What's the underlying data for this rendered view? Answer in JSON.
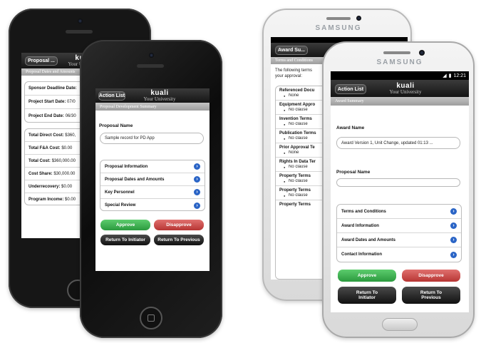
{
  "iphone_back": {
    "action_label": "Proposal ...",
    "logo_text": "kuali",
    "logo_sub": "Your University",
    "subbar": "Proposal Dates and Amounts",
    "dates": [
      {
        "label": "Sponsor Deadline Date:",
        "value": ""
      },
      {
        "label": "Project Start Date:",
        "value": "07/0"
      },
      {
        "label": "Project End Date:",
        "value": "06/30"
      }
    ],
    "costs": [
      {
        "label": "Total Direct Cost:",
        "value": "$360,"
      },
      {
        "label": "Total F&A Cost:",
        "value": "$0.00"
      },
      {
        "label": "Total Cost:",
        "value": "$360,000.00"
      },
      {
        "label": "Cost Share:",
        "value": "$30,000.00"
      },
      {
        "label": "Underrecovery:",
        "value": "$0.00"
      },
      {
        "label": "Program Income:",
        "value": "$0.00"
      }
    ]
  },
  "iphone_front": {
    "action_label": "Action List",
    "logo_text": "kuali",
    "logo_sub": "Your University",
    "subbar": "Proposal Development Summary",
    "name_label": "Proposal Name",
    "name_value": "Sample record for PD App",
    "items": [
      "Proposal Information",
      "Proposal Dates and Amounts",
      "Key Personnel",
      "Special Review"
    ],
    "approve": "Approve",
    "disapprove": "Disapprove",
    "return_initiator": "Return To Initiator",
    "return_previous": "Return To Previous"
  },
  "samsung_back": {
    "brand": "SAMSUNG",
    "action_label": "Award Su...",
    "subbar": "Terms and Conditions",
    "intro_line1": "The following terms",
    "intro_line2": "your approval:",
    "terms": [
      {
        "title": "Referenced Docu",
        "value": "None"
      },
      {
        "title": "Equipment Appro",
        "value": "No clause"
      },
      {
        "title": "Invention Terms",
        "value": "No clause"
      },
      {
        "title": "Publication Terms",
        "value": "No clause"
      },
      {
        "title": "Prior Approval Te",
        "value": "None"
      },
      {
        "title": "Rights In Data Ter",
        "value": "No clause"
      },
      {
        "title": "Property Terms",
        "value": "No clause"
      },
      {
        "title": "Property Terms",
        "value": "No clause"
      },
      {
        "title": "Property Terms",
        "value": ""
      }
    ]
  },
  "samsung_front": {
    "brand": "SAMSUNG",
    "time": "12:21",
    "action_label": "Action List",
    "logo_text": "kuali",
    "logo_sub": "Your University",
    "subbar": "Award Summary",
    "award_label": "Award Name",
    "award_value": "Award Version 1, Unit Change, updated 01:13 ...",
    "proposal_label": "Proposal Name",
    "proposal_value": "",
    "items": [
      "Terms and Conditions",
      "Award Information",
      "Award Dates and Amounts",
      "Contact Information"
    ],
    "approve": "Approve",
    "disapprove": "Disapprove",
    "return_initiator": "Return To Initiator",
    "return_previous": "Return To Previous"
  }
}
